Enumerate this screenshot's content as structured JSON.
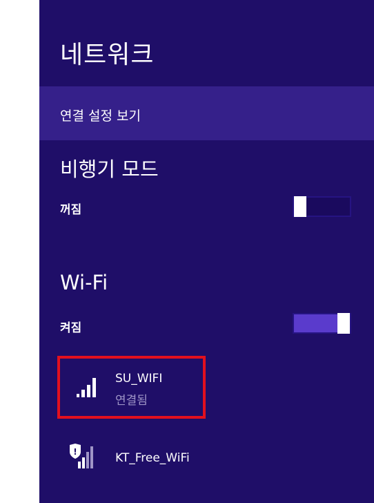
{
  "panel": {
    "title": "네트워크",
    "view_connection_settings": "연결 설정 보기"
  },
  "airplane_mode": {
    "title": "비행기 모드",
    "state": "꺼짐",
    "on": false
  },
  "wifi": {
    "title": "Wi-Fi",
    "state": "켜짐",
    "on": true
  },
  "networks": [
    {
      "name": "SU_WIFI",
      "status": "연결됨",
      "icon": "wifi-signal-icon",
      "highlighted": true
    },
    {
      "name": "KT_Free_WiFi",
      "status": "",
      "icon": "wifi-shield-signal-icon",
      "highlighted": false
    }
  ],
  "colors": {
    "panel_bg": "#1f0e68",
    "link_row_bg": "#35208a",
    "highlight_border": "#e3101e",
    "toggle_on_fill": "#5a3bcc"
  }
}
